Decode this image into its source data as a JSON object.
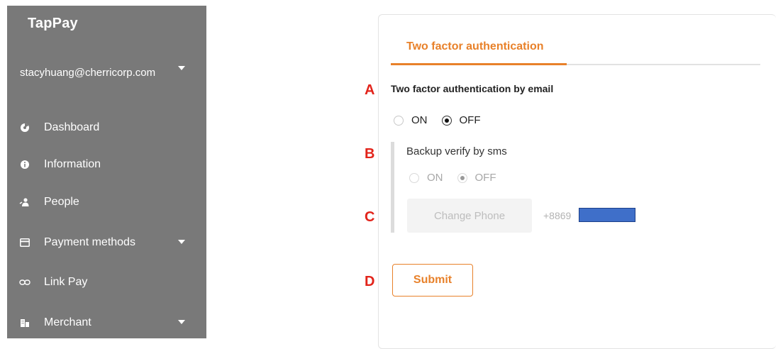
{
  "sidebar": {
    "brand": "TapPay",
    "account": "stacyhuang@cherricorp.com",
    "items": [
      {
        "label": "Dashboard",
        "icon": "dashboard-icon"
      },
      {
        "label": "Information",
        "icon": "info-icon"
      },
      {
        "label": "People",
        "icon": "people-icon"
      },
      {
        "label": "Payment methods",
        "icon": "card-icon"
      },
      {
        "label": "Link Pay",
        "icon": "link-icon"
      },
      {
        "label": "Merchant",
        "icon": "building-icon"
      }
    ]
  },
  "main": {
    "tab_label": "Two factor authentication",
    "section_title": "Two factor authentication by email",
    "email_options": {
      "on": "ON",
      "off": "OFF",
      "selected": "OFF"
    },
    "backup": {
      "title": "Backup verify by sms",
      "options": {
        "on": "ON",
        "off": "OFF",
        "selected": "OFF"
      },
      "change_phone_label": "Change Phone",
      "phone_prefix": "+8869"
    },
    "submit_label": "Submit"
  },
  "annotations": {
    "a": "A",
    "b": "B",
    "c": "C",
    "d": "D"
  },
  "colors": {
    "accent": "#e8812a",
    "sidebar_bg": "#797979",
    "marker": "#e2231a",
    "redaction": "#3f6fc9"
  }
}
